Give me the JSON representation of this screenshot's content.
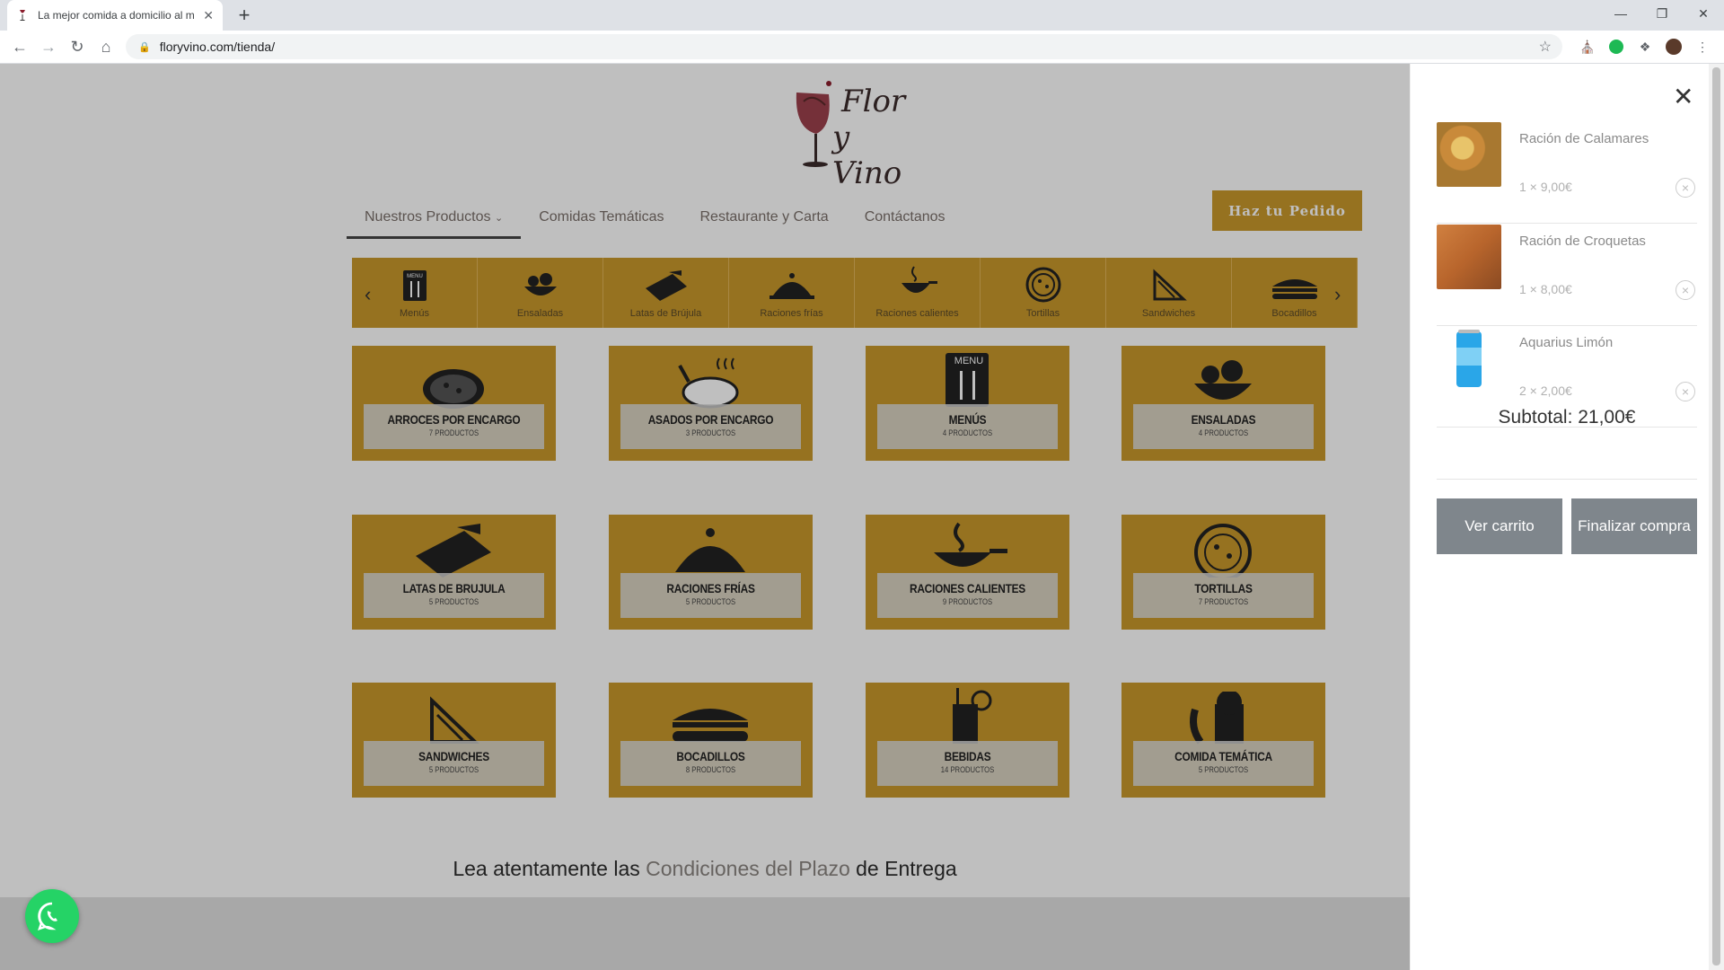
{
  "browser": {
    "tab_title": "La mejor comida a domicilio al m",
    "url": "floryvino.com/tienda/",
    "new_tab": "+",
    "tab_close": "✕"
  },
  "site": {
    "logo_line1": "Flor",
    "logo_line2": "y Vino",
    "nav": [
      "Nuestros Productos",
      "Comidas Temáticas",
      "Restaurante y Carta",
      "Contáctanos"
    ],
    "order_button": "Haz tu Pedido"
  },
  "category_bar": [
    "Menús",
    "Ensaladas",
    "Latas de Brújula",
    "Raciones frías",
    "Raciones calientes",
    "Tortillas",
    "Sandwiches",
    "Bocadillos"
  ],
  "categories": [
    {
      "name": "ARROCES POR ENCARGO",
      "count": "7 PRODUCTOS",
      "icon": "paella-icon"
    },
    {
      "name": "ASADOS POR ENCARGO",
      "count": "3 PRODUCTOS",
      "icon": "roast-chicken-icon"
    },
    {
      "name": "MENÚS",
      "count": "4 PRODUCTOS",
      "icon": "menu-icon"
    },
    {
      "name": "ENSALADAS",
      "count": "4 PRODUCTOS",
      "icon": "salad-icon"
    },
    {
      "name": "LATAS DE BRUJULA",
      "count": "5 PRODUCTOS",
      "icon": "tin-can-icon"
    },
    {
      "name": "RACIONES FRÍAS",
      "count": "5 PRODUCTOS",
      "icon": "cloche-icon"
    },
    {
      "name": "RACIONES CALIENTES",
      "count": "9 PRODUCTOS",
      "icon": "hot-pan-icon"
    },
    {
      "name": "TORTILLAS",
      "count": "7 PRODUCTOS",
      "icon": "tortilla-icon"
    },
    {
      "name": "SANDWICHES",
      "count": "5 PRODUCTOS",
      "icon": "sandwich-icon"
    },
    {
      "name": "BOCADILLOS",
      "count": "8 PRODUCTOS",
      "icon": "bocadillo-icon"
    },
    {
      "name": "BEBIDAS",
      "count": "14 PRODUCTOS",
      "icon": "drink-icon"
    },
    {
      "name": "COMIDA TEMÁTICA",
      "count": "5 PRODUCTOS",
      "icon": "themed-food-icon"
    }
  ],
  "conditions": {
    "prefix": "Lea atentamente las",
    "link": "Condiciones del Plazo",
    "suffix": "de Entrega"
  },
  "cart": {
    "items": [
      {
        "name": "Ración de Calamares",
        "qty": "1 × 9,00€"
      },
      {
        "name": "Ración de Croquetas",
        "qty": "1 × 8,00€"
      },
      {
        "name": "Aquarius Limón",
        "qty": "2 × 2,00€"
      }
    ],
    "subtotal": "Subtotal: 21,00€",
    "view_cart": "Ver carrito",
    "checkout": "Finalizar compra"
  },
  "colors": {
    "gold": "#c9982b",
    "whatsapp": "#25d366",
    "cart_button": "#7f868c"
  }
}
